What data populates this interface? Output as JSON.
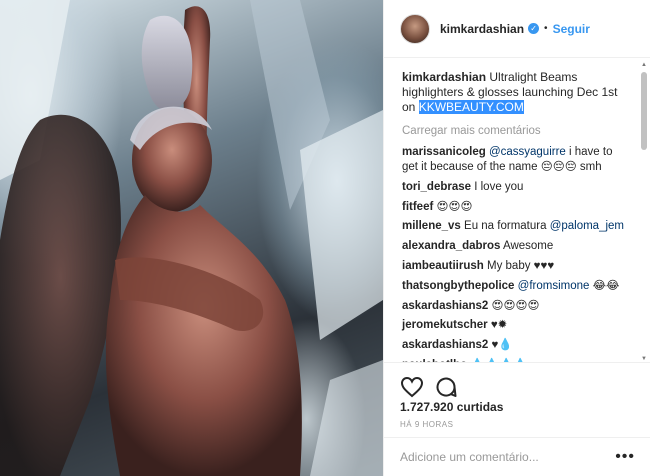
{
  "post": {
    "username": "kimkardashian",
    "follow_label": "Seguir",
    "separator": "•",
    "caption_text": "Ultralight Beams highlighters & glosses launching Dec 1st on ",
    "caption_link": "KKWBEAUTY.COM",
    "load_more": "Carregar mais comentários",
    "likes": "1.727.920 curtidas",
    "time": "HÁ 9 HORAS",
    "add_comment_placeholder": "Adicione um comentário...",
    "more_label": "•••"
  },
  "comments": [
    {
      "user": "marissanicoleg",
      "text_pre": "",
      "mention": "@cassyaguirre",
      "text_post": " i have to get it because of the name 😔😔😔 smh"
    },
    {
      "user": "tori_debrase",
      "text_pre": " I love you",
      "mention": "",
      "text_post": ""
    },
    {
      "user": "fitfeef",
      "text_pre": " 😍😍😍",
      "mention": "",
      "text_post": ""
    },
    {
      "user": "millene_vs",
      "text_pre": " Eu na formatura ",
      "mention": "@paloma_jem",
      "text_post": ""
    },
    {
      "user": "alexandra_dabros",
      "text_pre": " Awesome",
      "mention": "",
      "text_post": ""
    },
    {
      "user": "iambeautiirush",
      "text_pre": " My baby ♥♥♥",
      "mention": "",
      "text_post": ""
    },
    {
      "user": "thatsongbythepolice",
      "text_pre": " ",
      "mention": "@fromsimone",
      "text_post": " 😂😂"
    },
    {
      "user": "askardashians2",
      "text_pre": " 😍😍😍😍",
      "mention": "",
      "text_post": ""
    },
    {
      "user": "jeromekutscher",
      "text_pre": " ♥✹",
      "mention": "",
      "text_post": ""
    },
    {
      "user": "askardashians2",
      "text_pre": " ♥💧",
      "mention": "",
      "text_post": ""
    },
    {
      "user": "paulabotlho",
      "text_pre": " 💧💧💧💧",
      "mention": "",
      "text_post": ""
    }
  ],
  "icons": {
    "verified": "verified-badge-icon",
    "heart": "heart-icon",
    "comment": "comment-icon"
  },
  "colors": {
    "link": "#3897f0",
    "highlight": "#3390ff",
    "muted": "#999999",
    "text": "#262626"
  }
}
